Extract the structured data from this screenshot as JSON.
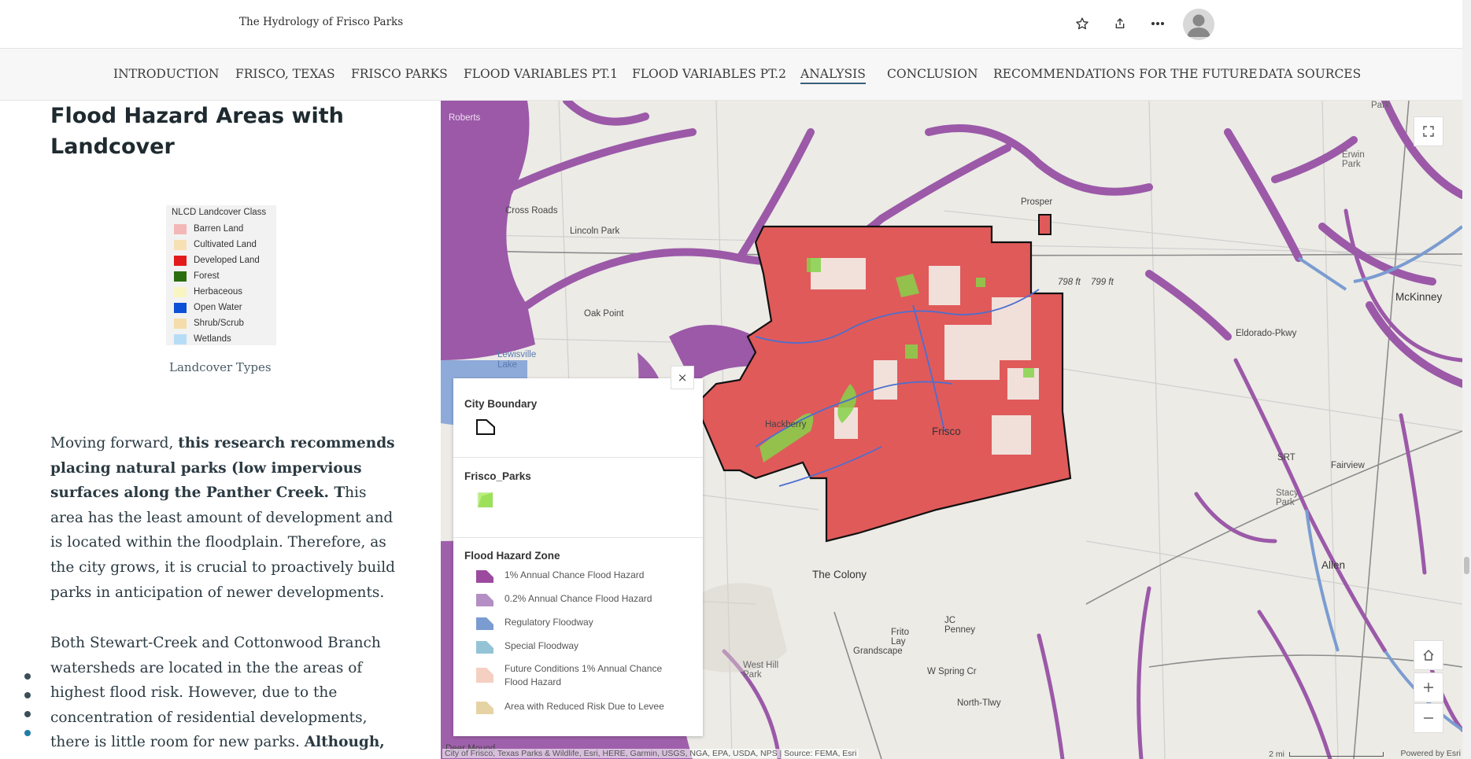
{
  "header": {
    "story_title": "The Hydrology of Frisco Parks",
    "icons": [
      "star-icon",
      "share-icon",
      "more-icon",
      "avatar"
    ]
  },
  "nav": {
    "items": [
      {
        "label": "INTRODUCTION"
      },
      {
        "label": "FRISCO, TEXAS"
      },
      {
        "label": "FRISCO PARKS"
      },
      {
        "label": "FLOOD VARIABLES PT.1"
      },
      {
        "label": "FLOOD VARIABLES PT.2"
      },
      {
        "label": "ANALYSIS",
        "active": true
      },
      {
        "label": "CONCLUSION"
      },
      {
        "label": "RECOMMENDATIONS FOR THE FUTURE"
      },
      {
        "label": "DATA SOURCES"
      }
    ]
  },
  "content": {
    "section_title": "Flood Hazard Areas with Landcover",
    "landcover_legend": {
      "title": "NLCD Landcover Class",
      "items": [
        {
          "label": "Barren Land",
          "color": "#f3b7b7"
        },
        {
          "label": "Cultivated Land",
          "color": "#f7e0b3"
        },
        {
          "label": "Developed Land",
          "color": "#e31a1c"
        },
        {
          "label": "Forest",
          "color": "#2a6e10"
        },
        {
          "label": "Herbaceous",
          "color": "#f8f5c3"
        },
        {
          "label": "Open Water",
          "color": "#0d4fd6"
        },
        {
          "label": "Shrub/Scrub",
          "color": "#f4ddaa"
        },
        {
          "label": "Wetlands",
          "color": "#b7ddf6"
        }
      ]
    },
    "caption": "Landcover Types",
    "para1": {
      "t1": "Moving forward, ",
      "b1": "this research recommends placing natural parks (low impervious surfaces along the Panther Creek. T",
      "t2": "his area has the least amount of development and is located within the floodplain. Therefore, as the city grows, it is crucial to proactively build parks in anticipation of newer developments."
    },
    "para2": {
      "t1": "Both Stewart-Creek and Cottonwood Branch watersheds are located in the the areas of highest flood risk. However, due to the concentration of residential developments, there is little room for new parks. ",
      "b1": "Although,"
    }
  },
  "map": {
    "labels": {
      "roberts": "Roberts",
      "lincoln_park": "Lincoln Park",
      "cross_roads": "Cross Roads",
      "oak_point": "Oak Point",
      "lewisville_lake": "Lewisville Lake",
      "prosper": "Prosper",
      "frisco": "Frisco",
      "hackberry": "Hackberry",
      "the_colony": "The Colony",
      "mckinney": "McKinney",
      "fairview": "Fairview",
      "allen": "Allen",
      "erwin_park": "Erwin Park",
      "stacy_park": "Stacy Park",
      "grandscape": "Grandscape",
      "jc_penney": "JC Penney",
      "frito_lay": "Frito Lay",
      "west_hill_park": "West Hill Park",
      "w_spring_creek": "W Spring Cr",
      "park": "Park",
      "srt": "SRT",
      "elev_798": "798 ft",
      "elev_799": "799 ft",
      "eldorado": "Eldorado-Pkwy",
      "north_tlwy": "North-Tlwy",
      "deer_mound": "Deer Mound"
    },
    "attribution": "City of Frisco, Texas Parks & Wildlife, Esri, HERE, Garmin, USGS, NGA, EPA, USDA, NPS | Source: FEMA, Esri",
    "scale_label": "2 mi",
    "powered_by": "Powered by Esri",
    "legend": {
      "close_label": "×",
      "city_boundary_title": "City Boundary",
      "parks_title": "Frisco_Parks",
      "flood_title": "Flood Hazard Zone",
      "flood_items": [
        {
          "label": "1% Annual Chance Flood Hazard",
          "color": "#9b4a9e"
        },
        {
          "label": "0.2% Annual Chance Flood Hazard",
          "color": "#b48fc4"
        },
        {
          "label": "Regulatory Floodway",
          "color": "#7b9cd0"
        },
        {
          "label": "Special Floodway",
          "color": "#94c3d6"
        },
        {
          "label": "Future Conditions 1% Annual Chance Flood Hazard",
          "color": "#f6cfc3"
        },
        {
          "label": "Area with Reduced Risk Due to Levee",
          "color": "#e6d3a3"
        }
      ]
    }
  }
}
